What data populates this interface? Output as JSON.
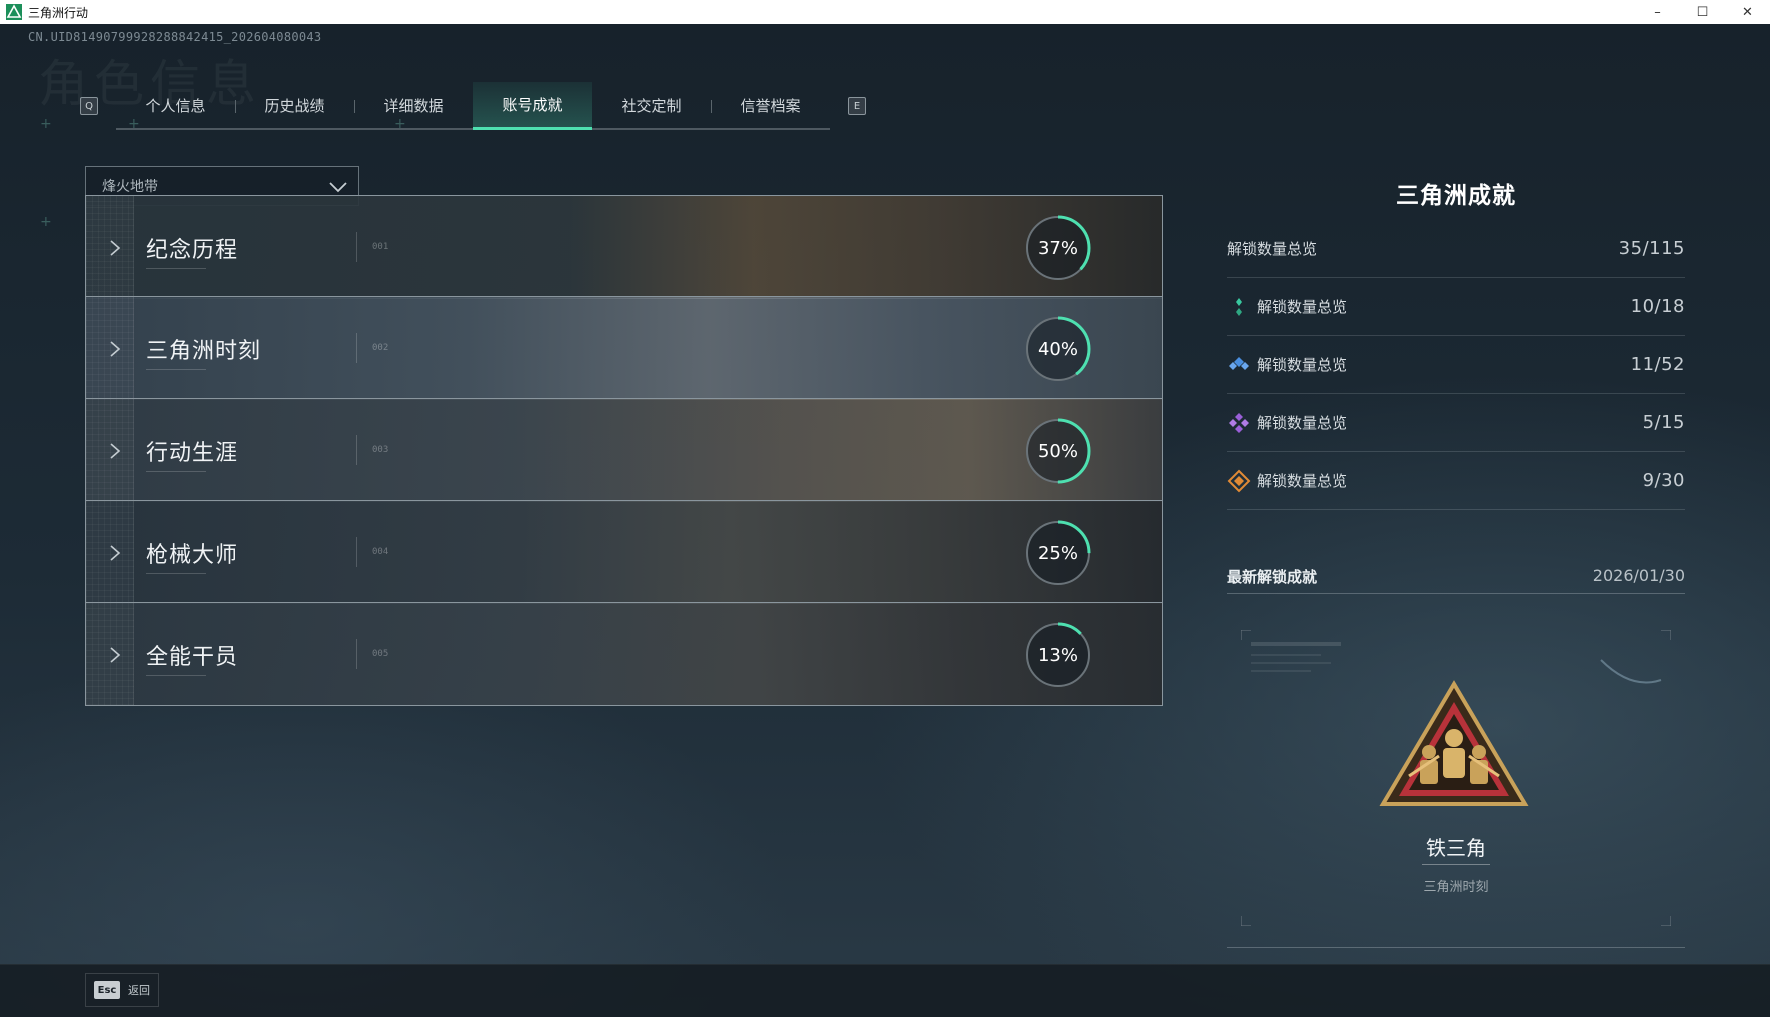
{
  "window": {
    "title": "三角洲行动",
    "controls": {
      "minimize": "–",
      "maximize": "☐",
      "close": "✕"
    }
  },
  "header": {
    "uid": "CN.UID8149079992828884​2415_202604080043",
    "watermark": "角色信息"
  },
  "tabs": {
    "prev_key": "Q",
    "next_key": "E",
    "items": [
      {
        "label": "个人信息",
        "active": false
      },
      {
        "label": "历史战绩",
        "active": false
      },
      {
        "label": "详细数据",
        "active": false
      },
      {
        "label": "账号成就",
        "active": true
      },
      {
        "label": "社交定制",
        "active": false
      },
      {
        "label": "信誉档案",
        "active": false
      }
    ]
  },
  "mode_select": {
    "value": "烽火地带"
  },
  "categories": [
    {
      "name": "纪念历程",
      "index": "001",
      "progress": 37,
      "progress_label": "37%"
    },
    {
      "name": "三角洲时刻",
      "index": "002",
      "progress": 40,
      "progress_label": "40%"
    },
    {
      "name": "行动生涯",
      "index": "003",
      "progress": 50,
      "progress_label": "50%"
    },
    {
      "name": "枪械大师",
      "index": "004",
      "progress": 25,
      "progress_label": "25%"
    },
    {
      "name": "全能干员",
      "index": "005",
      "progress": 13,
      "progress_label": "13%"
    }
  ],
  "summary": {
    "title": "三角洲成就",
    "total": {
      "label": "解锁数量总览",
      "value": "35/115"
    },
    "tiers": [
      {
        "label": "解锁数量总览",
        "value": "10/18",
        "icon": "green-tier-icon",
        "color": "#39c9a0"
      },
      {
        "label": "解锁数量总览",
        "value": "11/52",
        "icon": "blue-tier-icon",
        "color": "#4a8fe0"
      },
      {
        "label": "解锁数量总览",
        "value": "5/15",
        "icon": "purple-tier-icon",
        "color": "#9a5fd8"
      },
      {
        "label": "解锁数量总览",
        "value": "9/30",
        "icon": "orange-tier-icon",
        "color": "#e08a35"
      }
    ]
  },
  "latest": {
    "label": "最新解锁成就",
    "date": "2026/01/30",
    "badge_name": "铁三角",
    "badge_category": "三角洲时刻"
  },
  "footer": {
    "esc_key": "Esc",
    "back_label": "返回"
  },
  "colors": {
    "accent": "#4ee0b0",
    "ring_track": "#6a7379"
  }
}
